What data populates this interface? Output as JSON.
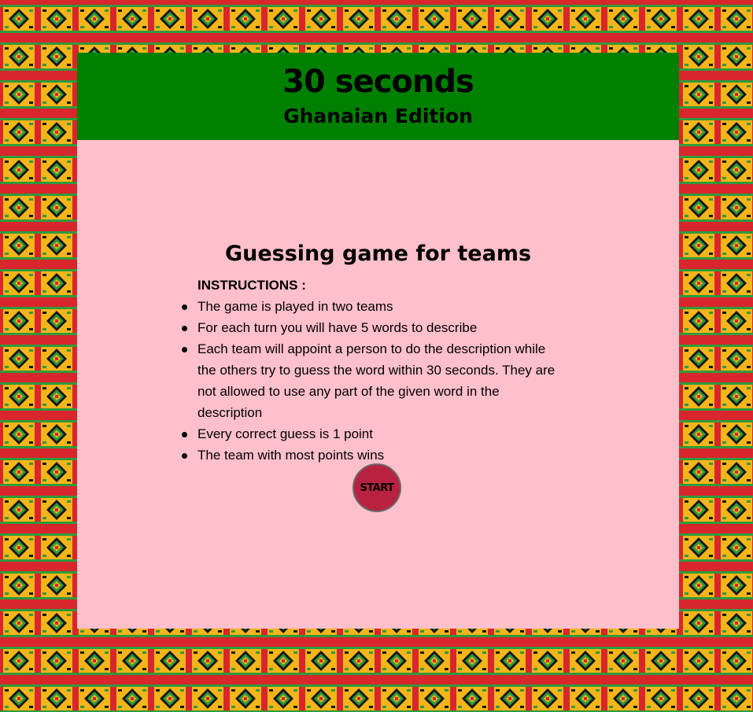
{
  "header": {
    "title": "30 seconds",
    "subtitle": "Ghanaian Edition"
  },
  "main": {
    "tagline": "Guessing game for teams",
    "instructions_heading": "INSTRUCTIONS :",
    "instructions": [
      "The game is played in two teams",
      "For each turn you will have 5 words to describe",
      "Each team will appoint a person to do the description while the others try to guess the word within 30 seconds. They are not allowed to use any part of the given word in the description",
      "Every correct guess is 1 point",
      "The team with most points wins"
    ],
    "start_label": "START"
  },
  "colors": {
    "header_bg": "#008000",
    "card_bg": "#ffc0cb",
    "start_button": "#b82240",
    "kente_gold": "#f3b51a",
    "kente_red": "#d8262c",
    "kente_green": "#2f9a3c",
    "kente_black": "#161616"
  },
  "background": {
    "pattern": "kente-cloth"
  }
}
